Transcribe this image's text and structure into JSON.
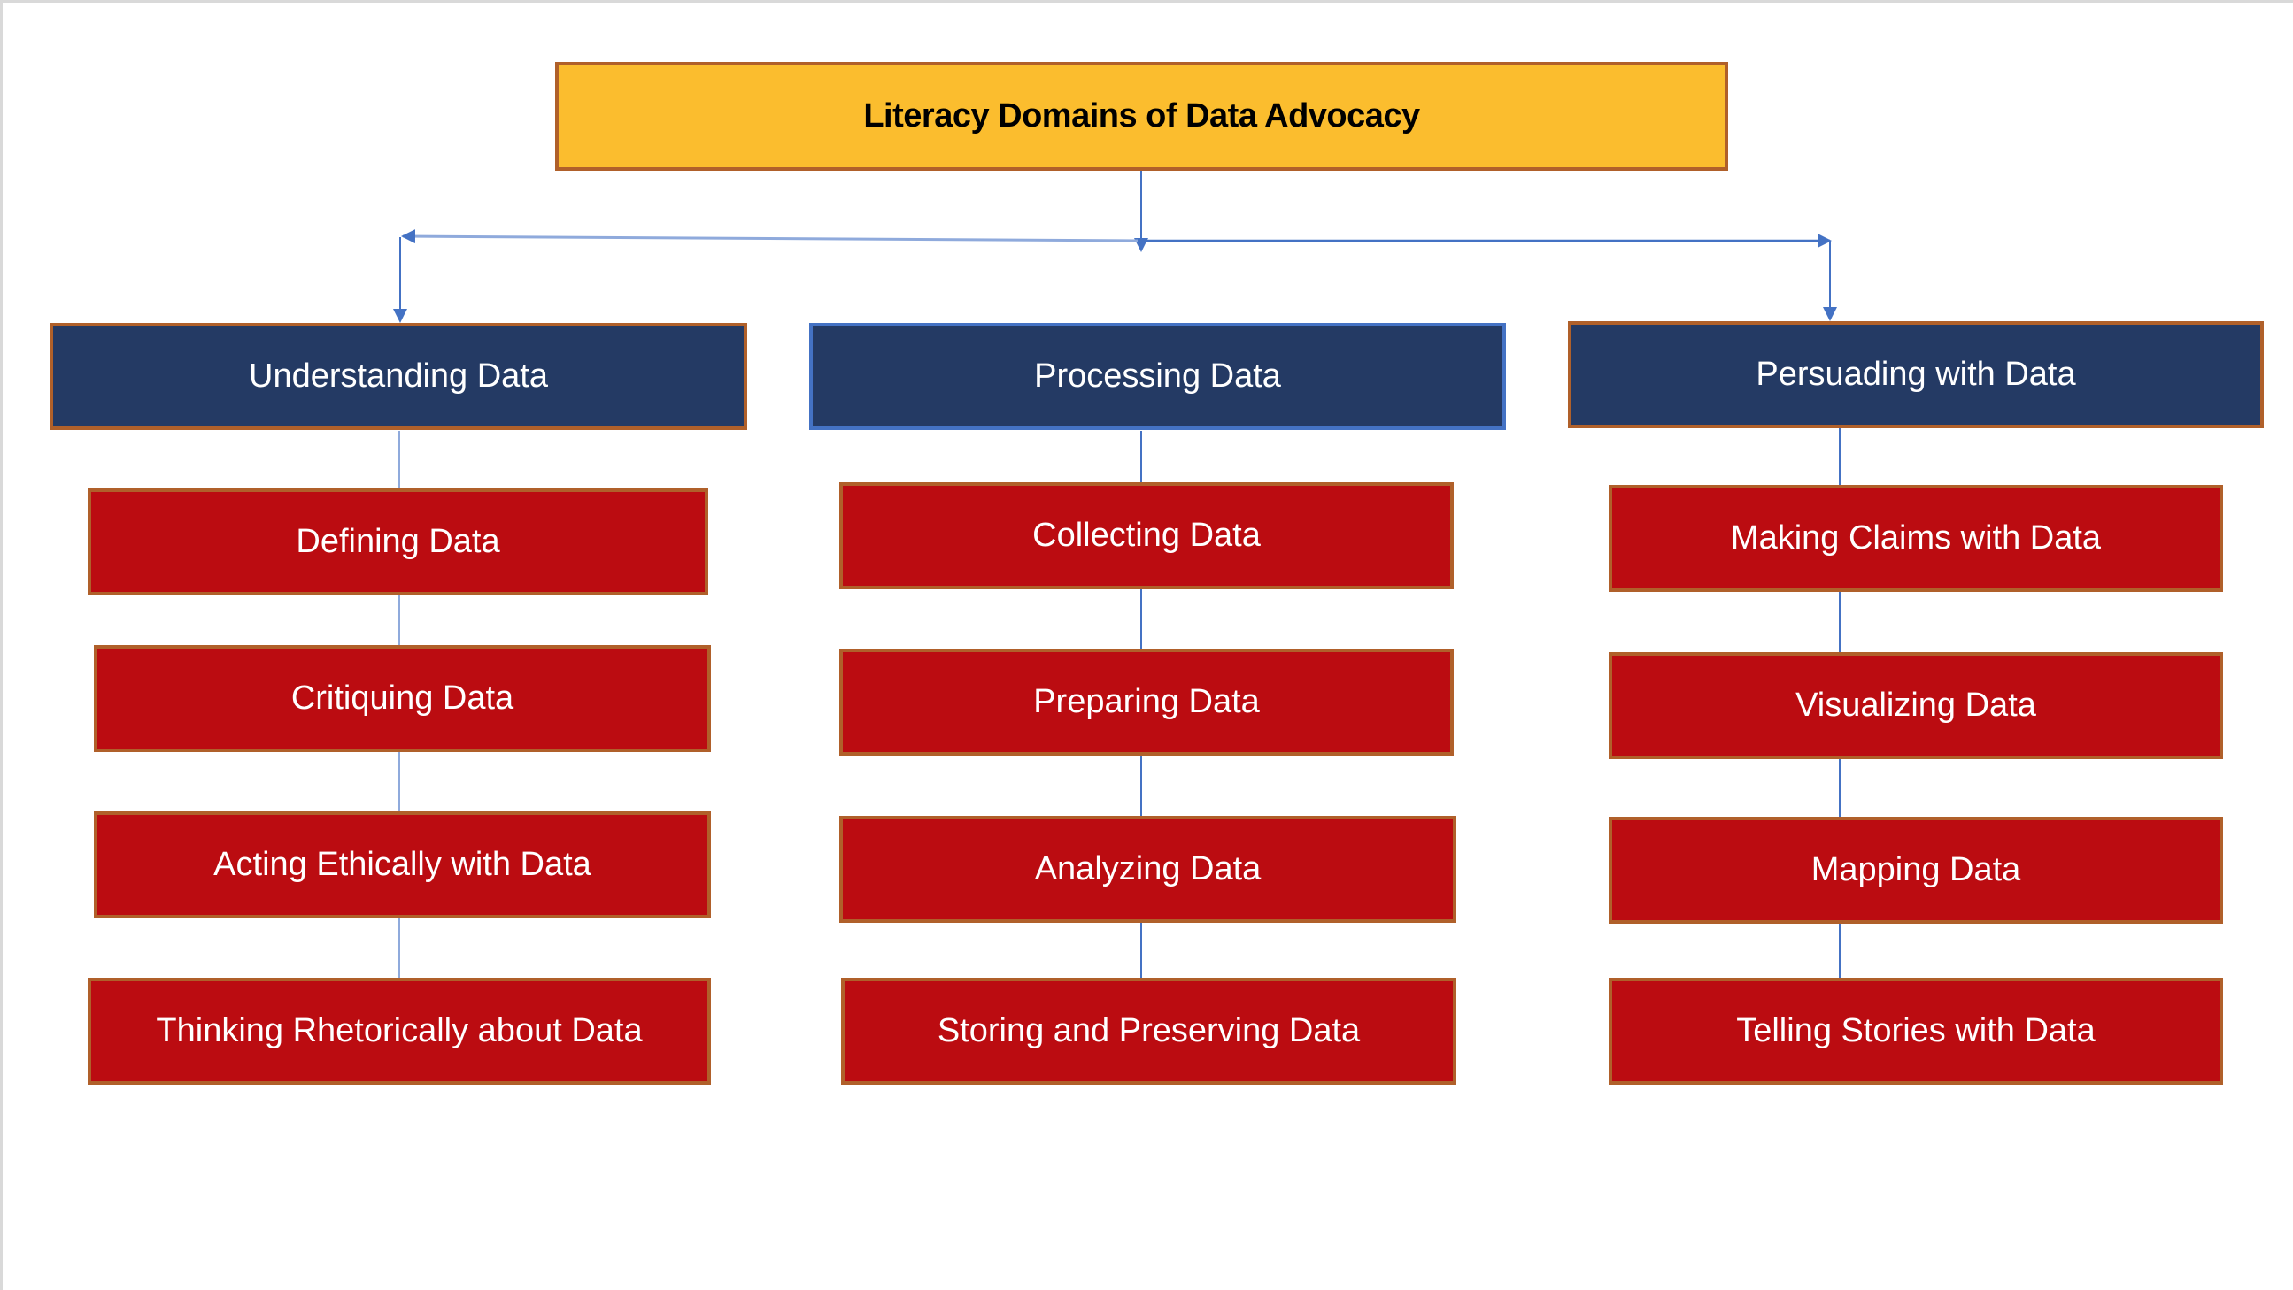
{
  "title": "Literacy Domains of Data Advocacy",
  "colors": {
    "title_fill": "#FBBD2E",
    "domain_fill": "#243A64",
    "skill_fill": "#BB0C11",
    "box_border": "#B0602A",
    "connector": "#4472C4"
  },
  "domains": [
    {
      "label": "Understanding Data",
      "skills": [
        "Defining Data",
        "Critiquing Data",
        "Acting Ethically with Data",
        "Thinking Rhetorically about Data"
      ]
    },
    {
      "label": "Processing Data",
      "skills": [
        "Collecting Data",
        "Preparing Data",
        "Analyzing Data",
        "Storing and Preserving Data"
      ]
    },
    {
      "label": "Persuading with Data",
      "skills": [
        "Making Claims with Data",
        "Visualizing Data",
        "Mapping Data",
        "Telling Stories with Data"
      ]
    }
  ]
}
